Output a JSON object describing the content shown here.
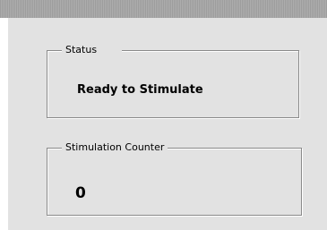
{
  "status_group": {
    "legend": "Status",
    "value": "Ready to Stimulate"
  },
  "counter_group": {
    "legend": "Stimulation Counter",
    "value": "0"
  }
}
